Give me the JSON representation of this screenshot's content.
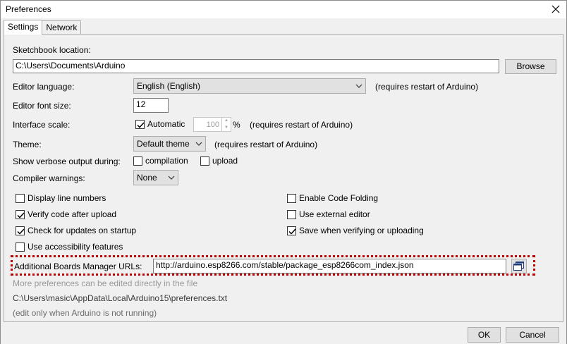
{
  "window": {
    "title": "Preferences"
  },
  "tabs": [
    {
      "label": "Settings"
    },
    {
      "label": "Network"
    }
  ],
  "sketchbook": {
    "label": "Sketchbook location:",
    "value": "C:\\Users\\Documents\\Arduino",
    "browse_label": "Browse"
  },
  "editor_language": {
    "label": "Editor language:",
    "value": "English (English)",
    "note": "(requires restart of Arduino)"
  },
  "font_size": {
    "label": "Editor font size:",
    "value": "12"
  },
  "interface_scale": {
    "label": "Interface scale:",
    "automatic_label": "Automatic",
    "automatic_checked": true,
    "value": "100",
    "unit": "%",
    "note": "(requires restart of Arduino)"
  },
  "theme": {
    "label": "Theme:",
    "value": "Default theme",
    "note": "(requires restart of Arduino)"
  },
  "verbose": {
    "label": "Show verbose output during:",
    "compilation_label": "compilation",
    "upload_label": "upload"
  },
  "warnings": {
    "label": "Compiler warnings:",
    "value": "None"
  },
  "options_left": [
    {
      "label": "Display line numbers",
      "checked": false
    },
    {
      "label": "Verify code after upload",
      "checked": true
    },
    {
      "label": "Check for updates on startup",
      "checked": true
    },
    {
      "label": "Use accessibility features",
      "checked": false
    }
  ],
  "options_right": [
    {
      "label": "Enable Code Folding",
      "checked": false
    },
    {
      "label": "Use external editor",
      "checked": false
    },
    {
      "label": "Save when verifying or uploading",
      "checked": true
    }
  ],
  "boards_urls": {
    "label": "Additional Boards Manager URLs:",
    "value": "http://arduino.esp8266.com/stable/package_esp8266com_index.json"
  },
  "info": {
    "line1": "More preferences can be edited directly in the file",
    "path": "C:\\Users\\masic\\AppData\\Local\\Arduino15\\preferences.txt",
    "line3": "(edit only when Arduino is not running)"
  },
  "buttons": {
    "ok": "OK",
    "cancel": "Cancel"
  },
  "colors": {
    "highlight_border": "#c00000",
    "background": "#f0f0f0"
  }
}
